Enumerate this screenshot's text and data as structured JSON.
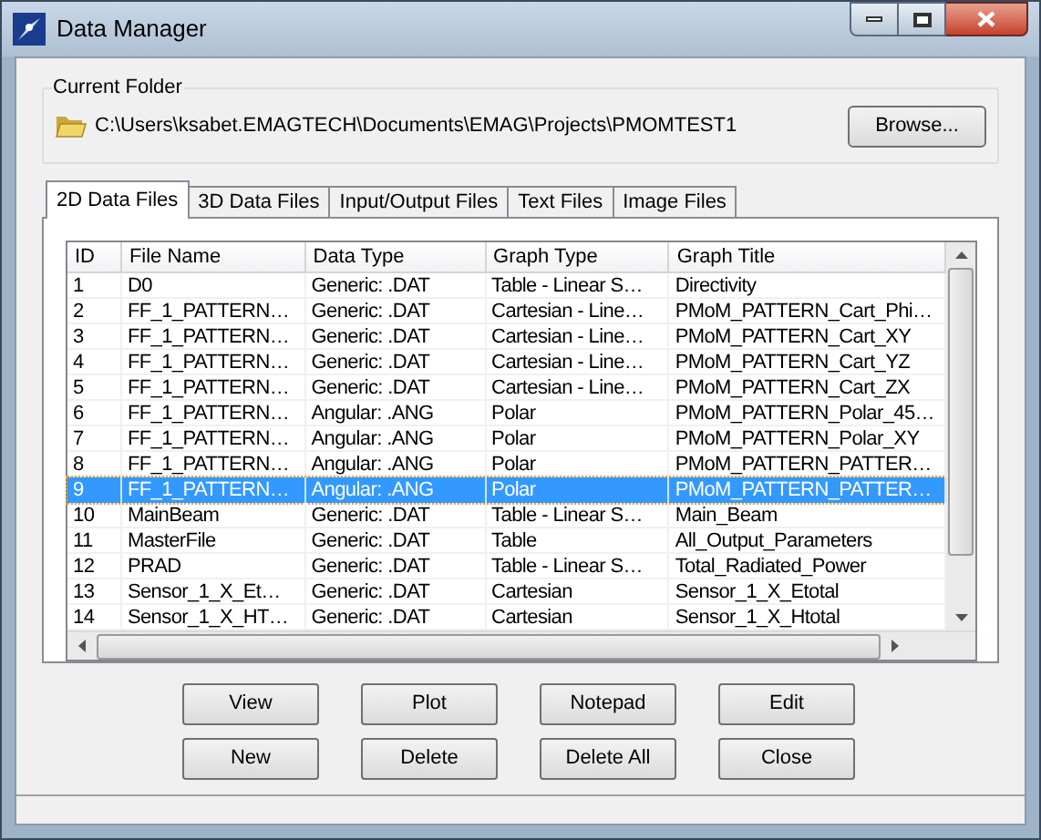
{
  "window": {
    "title": "Data Manager"
  },
  "current_folder": {
    "label": "Current Folder",
    "path": "C:\\Users\\ksabet.EMAGTECH\\Documents\\EMAG\\Projects\\PMOMTEST1",
    "browse_button": "Browse..."
  },
  "tabs": [
    {
      "label": "2D Data Files",
      "selected": true
    },
    {
      "label": "3D Data Files",
      "selected": false
    },
    {
      "label": "Input/Output Files",
      "selected": false
    },
    {
      "label": "Text Files",
      "selected": false
    },
    {
      "label": "Image Files",
      "selected": false
    }
  ],
  "table": {
    "columns": [
      "ID",
      "File Name",
      "Data Type",
      "Graph Type",
      "Graph Title"
    ],
    "rows": [
      {
        "cells": [
          "1",
          "D0",
          "Generic: .DAT",
          "Table - Linear S…",
          "Directivity"
        ],
        "selected": false
      },
      {
        "cells": [
          "2",
          "FF_1_PATTERN…",
          "Generic: .DAT",
          "Cartesian - Line…",
          "PMoM_PATTERN_Cart_Phi…"
        ],
        "selected": false
      },
      {
        "cells": [
          "3",
          "FF_1_PATTERN…",
          "Generic: .DAT",
          "Cartesian - Line…",
          "PMoM_PATTERN_Cart_XY"
        ],
        "selected": false
      },
      {
        "cells": [
          "4",
          "FF_1_PATTERN…",
          "Generic: .DAT",
          "Cartesian - Line…",
          "PMoM_PATTERN_Cart_YZ"
        ],
        "selected": false
      },
      {
        "cells": [
          "5",
          "FF_1_PATTERN…",
          "Generic: .DAT",
          "Cartesian - Line…",
          "PMoM_PATTERN_Cart_ZX"
        ],
        "selected": false
      },
      {
        "cells": [
          "6",
          "FF_1_PATTERN…",
          "Angular: .ANG",
          "Polar",
          "PMoM_PATTERN_Polar_45…"
        ],
        "selected": false
      },
      {
        "cells": [
          "7",
          "FF_1_PATTERN…",
          "Angular: .ANG",
          "Polar",
          "PMoM_PATTERN_Polar_XY"
        ],
        "selected": false
      },
      {
        "cells": [
          "8",
          "FF_1_PATTERN…",
          "Angular: .ANG",
          "Polar",
          "PMoM_PATTERN_PATTER…"
        ],
        "selected": false
      },
      {
        "cells": [
          "9",
          "FF_1_PATTERN…",
          "Angular: .ANG",
          "Polar",
          "PMoM_PATTERN_PATTER…"
        ],
        "selected": true
      },
      {
        "cells": [
          "10",
          "MainBeam",
          "Generic: .DAT",
          "Table - Linear S…",
          "Main_Beam"
        ],
        "selected": false
      },
      {
        "cells": [
          "11",
          "MasterFile",
          "Generic: .DAT",
          "Table",
          "All_Output_Parameters"
        ],
        "selected": false
      },
      {
        "cells": [
          "12",
          "PRAD",
          "Generic: .DAT",
          "Table - Linear S…",
          "Total_Radiated_Power"
        ],
        "selected": false
      },
      {
        "cells": [
          "13",
          "Sensor_1_X_Et…",
          "Generic: .DAT",
          "Cartesian",
          "Sensor_1_X_Etotal"
        ],
        "selected": false
      },
      {
        "cells": [
          "14",
          "Sensor_1_X_HT…",
          "Generic: .DAT",
          "Cartesian",
          "Sensor_1_X_Htotal"
        ],
        "selected": false
      }
    ]
  },
  "buttons": [
    [
      "View",
      "Plot",
      "Notepad",
      "Edit"
    ],
    [
      "New",
      "Delete",
      "Delete All",
      "Close"
    ]
  ]
}
